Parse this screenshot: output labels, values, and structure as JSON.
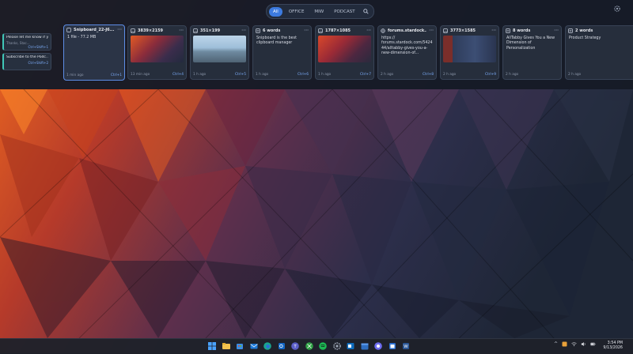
{
  "filters": {
    "tabs": [
      {
        "label": "All",
        "active": true
      },
      {
        "label": "OFFICE",
        "active": false
      },
      {
        "label": "MIW",
        "active": false
      },
      {
        "label": "PODCAST",
        "active": false
      }
    ]
  },
  "pinned": [
    {
      "title": "Please let me know if y...",
      "sub": "Thanks, Stac...",
      "shortcut": "Ctrl+Shift+1"
    },
    {
      "title": "Subscribe to the Podc...",
      "sub": "",
      "shortcut": "Ctrl+Shift+2"
    }
  ],
  "cards": [
    {
      "title": "Snipboard_22-J6...",
      "text": "1 file - 77.2 MB",
      "time": "1 min ago",
      "shortcut": "Ctrl+1"
    },
    {
      "title": "3839×2159",
      "time": "13 min ago",
      "shortcut": "Ctrl+4"
    },
    {
      "title": "351×199",
      "time": "1 h ago",
      "shortcut": "Ctrl+5"
    },
    {
      "title": "6 words",
      "text": "Snipboard is the best clipboard manager",
      "time": "1 h ago",
      "shortcut": "Ctrl+6"
    },
    {
      "title": "1787×1085",
      "time": "1 h ago",
      "shortcut": "Ctrl+7"
    },
    {
      "title": "forums.stardock...",
      "text": "https:// forums.stardock.com/5424 44/alltabby-gives-you-a-new-dimension-of...",
      "time": "2 h ago",
      "shortcut": "Ctrl+8"
    },
    {
      "title": "3773×1585",
      "time": "2 h ago",
      "shortcut": "Ctrl+9"
    },
    {
      "title": "8 words",
      "text": "AllTabby Gives You a New Dimension of Personalization",
      "time": "2 h ago",
      "shortcut": ""
    },
    {
      "title": "2 words",
      "text": "Product Strategy",
      "time": "2 h ago",
      "shortcut": ""
    }
  ],
  "clock": {
    "time": "3:54 PM",
    "date": "9/13/2026"
  },
  "icons": {
    "file": "file-icon",
    "image": "image-icon",
    "text": "text-icon",
    "link": "link-icon",
    "search": "search-icon",
    "settings": "gear-icon"
  },
  "colors": {
    "accent": "#3d7be0",
    "pin_accent": "#40c7b8",
    "shortcut": "#7fb0ff"
  }
}
